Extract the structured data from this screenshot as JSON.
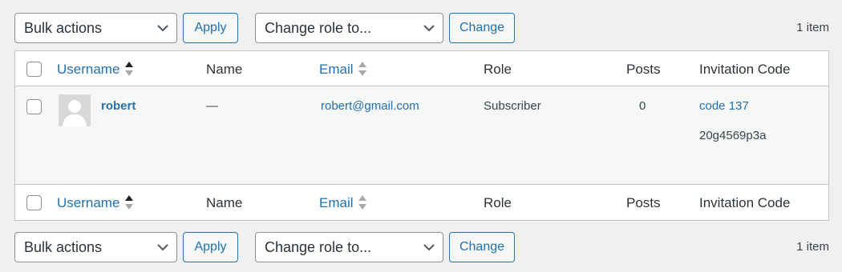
{
  "tablenav": {
    "bulk_actions": "Bulk actions",
    "apply": "Apply",
    "change_role": "Change role to...",
    "change": "Change",
    "count": "1 item"
  },
  "columns": {
    "username": "Username",
    "name": "Name",
    "email": "Email",
    "role": "Role",
    "posts": "Posts",
    "invitation_code": "Invitation Code"
  },
  "row": {
    "username": "robert",
    "name": "—",
    "email": "robert@gmail.com",
    "role": "Subscriber",
    "posts": "0",
    "invitation_code_link": "code 137",
    "invitation_code_value": "20g4569p3a"
  },
  "colors": {
    "accent": "#2271b1",
    "row_bg": "#f6f7f7",
    "page_bg": "#f0f0f1"
  }
}
